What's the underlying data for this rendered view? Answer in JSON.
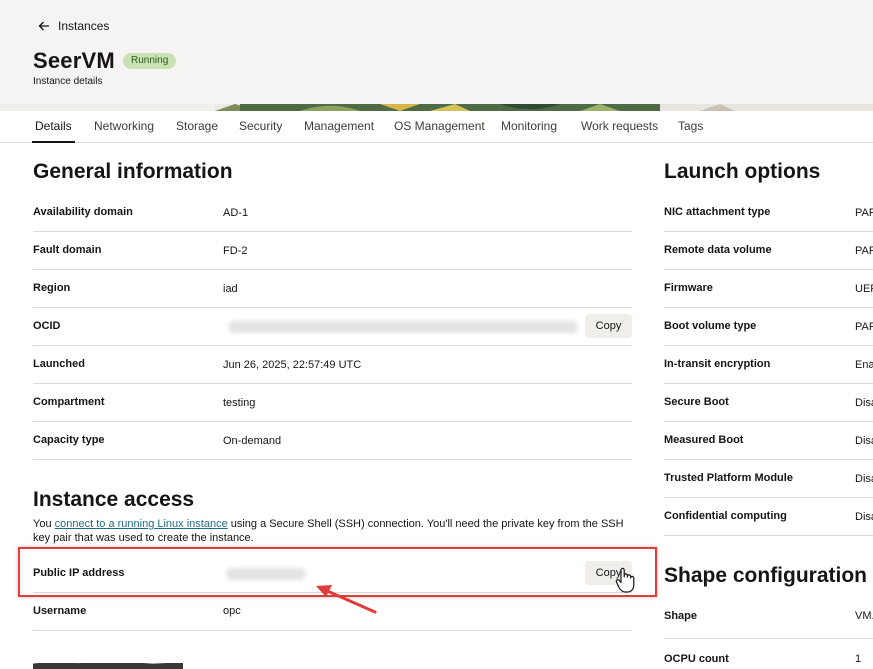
{
  "header": {
    "back_label": "Instances",
    "instance_name": "SeerVM",
    "status": "Running",
    "subtitle": "Instance details"
  },
  "tabs": [
    {
      "label": "Details",
      "active": true
    },
    {
      "label": "Networking"
    },
    {
      "label": "Storage"
    },
    {
      "label": "Security"
    },
    {
      "label": "Management"
    },
    {
      "label": "OS Management"
    },
    {
      "label": "Monitoring"
    },
    {
      "label": "Work requests"
    },
    {
      "label": "Tags"
    }
  ],
  "general": {
    "title": "General information",
    "copy_label": "Copy",
    "rows": [
      {
        "label": "Availability domain",
        "value": "AD-1"
      },
      {
        "label": "Fault domain",
        "value": "FD-2"
      },
      {
        "label": "Region",
        "value": "iad"
      },
      {
        "label": "OCID",
        "value": ""
      },
      {
        "label": "Launched",
        "value": "Jun 26, 2025, 22:57:49 UTC"
      },
      {
        "label": "Compartment",
        "value": "testing"
      },
      {
        "label": "Capacity type",
        "value": "On-demand"
      }
    ]
  },
  "access": {
    "title": "Instance access",
    "desc_prefix": "You ",
    "desc_link": "connect to a running Linux instance",
    "desc_suffix": " using a Secure Shell (SSH) connection. You'll need the private key from the SSH key pair that was used to create the instance.",
    "copy_label": "Copy",
    "rows": [
      {
        "label": "Public IP address",
        "value": ""
      },
      {
        "label": "Username",
        "value": "opc"
      }
    ]
  },
  "launch": {
    "title": "Launch options",
    "rows": [
      {
        "label": "NIC attachment type",
        "value": "PAR"
      },
      {
        "label": "Remote data volume",
        "value": "PAR"
      },
      {
        "label": "Firmware",
        "value": "UEF"
      },
      {
        "label": "Boot volume type",
        "value": "PAR"
      },
      {
        "label": "In-transit encryption",
        "value": "Ena"
      },
      {
        "label": "Secure Boot",
        "value": "Disa"
      },
      {
        "label": "Measured Boot",
        "value": "Disa"
      },
      {
        "label": "Trusted Platform Module",
        "value": "Disa"
      },
      {
        "label": "Confidential computing",
        "value": "Disa"
      }
    ]
  },
  "shape": {
    "title": "Shape configuration",
    "rows": [
      {
        "label": "Shape",
        "value": "VM."
      },
      {
        "label": "OCPU count",
        "value": "1"
      }
    ]
  },
  "colors": {
    "running_badge": "#c9e2b5",
    "link": "#1e6c82",
    "highlight": "#e03c3c"
  }
}
